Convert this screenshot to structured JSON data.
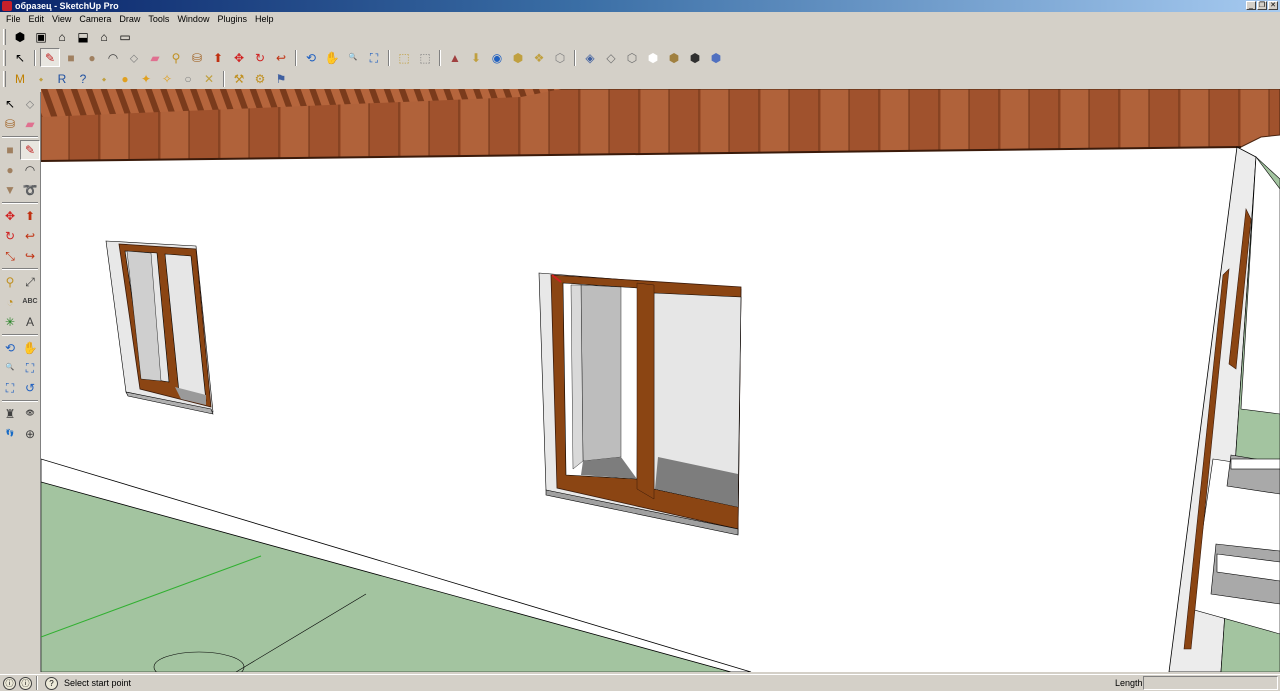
{
  "window": {
    "title": "образец - SketchUp Pro",
    "controls": {
      "minimize": "_",
      "restore": "❐",
      "close": "✕"
    }
  },
  "menu": [
    "File",
    "Edit",
    "View",
    "Camera",
    "Draw",
    "Tools",
    "Window",
    "Plugins",
    "Help"
  ],
  "toolbar_top": {
    "views": [
      {
        "name": "iso-view-icon",
        "glyph": "⬢"
      },
      {
        "name": "top-view-icon",
        "glyph": "▣"
      },
      {
        "name": "front-view-icon",
        "glyph": "⌂"
      },
      {
        "name": "right-view-icon",
        "glyph": "⬓"
      },
      {
        "name": "back-view-icon",
        "glyph": "⌂"
      },
      {
        "name": "left-view-icon",
        "glyph": "▭"
      }
    ]
  },
  "toolbar_main": [
    {
      "name": "select-icon",
      "glyph": "↖",
      "color": "#000000"
    },
    {
      "name": "line-icon",
      "glyph": "✎",
      "color": "#c02020",
      "selected": true
    },
    {
      "name": "rectangle-icon",
      "glyph": "■",
      "color": "#a08060"
    },
    {
      "name": "circle-icon",
      "glyph": "●",
      "color": "#a08060"
    },
    {
      "name": "arc-icon",
      "glyph": "◠",
      "color": "#404040"
    },
    {
      "name": "make-component-icon",
      "glyph": "⬦",
      "color": "#808080"
    },
    {
      "name": "eraser-icon",
      "glyph": "▰",
      "color": "#e07090"
    },
    {
      "name": "tape-measure-icon",
      "glyph": "⚲",
      "color": "#c09020"
    },
    {
      "name": "paint-bucket-icon",
      "glyph": "⛁",
      "color": "#a06020"
    },
    {
      "name": "push-pull-icon",
      "glyph": "⬆",
      "color": "#c03010"
    },
    {
      "name": "move-icon",
      "glyph": "✥",
      "color": "#d02020"
    },
    {
      "name": "rotate-icon",
      "glyph": "↻",
      "color": "#d02020"
    },
    {
      "name": "follow-me-icon",
      "glyph": "↩",
      "color": "#c03010"
    },
    {
      "name": "orbit-icon",
      "glyph": "⟲",
      "color": "#2060c0"
    },
    {
      "name": "pan-icon",
      "glyph": "✋",
      "color": "#404040"
    },
    {
      "name": "zoom-icon",
      "glyph": "🔍",
      "color": "#2060c0"
    },
    {
      "name": "zoom-extents-icon",
      "glyph": "⛶",
      "color": "#2060c0"
    },
    {
      "name": "previous-view-icon",
      "glyph": "⬚",
      "color": "#c0a040"
    },
    {
      "name": "next-view-icon",
      "glyph": "⬚",
      "color": "#808080"
    },
    {
      "name": "place-model-icon",
      "glyph": "▲",
      "color": "#a04040"
    },
    {
      "name": "get-models-icon",
      "glyph": "⬇",
      "color": "#c0a040"
    },
    {
      "name": "share-model-icon",
      "glyph": "◉",
      "color": "#2060c0"
    },
    {
      "name": "share-component-icon",
      "glyph": "⬢",
      "color": "#c0a040"
    },
    {
      "name": "component-icon",
      "glyph": "❖",
      "color": "#c0a040"
    },
    {
      "name": "warehouse-icon",
      "glyph": "⬡",
      "color": "#808080"
    },
    {
      "name": "xray-icon",
      "glyph": "◈",
      "color": "#4060a0"
    },
    {
      "name": "back-edges-icon",
      "glyph": "◇",
      "color": "#707070"
    },
    {
      "name": "wireframe-icon",
      "glyph": "⬡",
      "color": "#707070"
    },
    {
      "name": "hidden-line-icon",
      "glyph": "⬢",
      "color": "#ffffff"
    },
    {
      "name": "shaded-icon",
      "glyph": "⬢",
      "color": "#a08040"
    },
    {
      "name": "shaded-textures-icon",
      "glyph": "⬢",
      "color": "#303030"
    },
    {
      "name": "monochrome-icon",
      "glyph": "⬢",
      "color": "#5070c0"
    }
  ],
  "toolbar_plugins": [
    {
      "name": "plugin-m-icon",
      "glyph": "M",
      "color": "#c08000"
    },
    {
      "name": "plugin-tag-icon",
      "glyph": "⬩",
      "color": "#c0a040"
    },
    {
      "name": "plugin-r-icon",
      "glyph": "R",
      "color": "#2050a0"
    },
    {
      "name": "plugin-help-icon",
      "glyph": "?",
      "color": "#2050a0"
    },
    {
      "name": "plugin-tag2-icon",
      "glyph": "⬩",
      "color": "#c0a040"
    },
    {
      "name": "plugin-sphere-icon",
      "glyph": "●",
      "color": "#e0a020"
    },
    {
      "name": "plugin-light-icon",
      "glyph": "✦",
      "color": "#e0a020"
    },
    {
      "name": "plugin-light2-icon",
      "glyph": "✧",
      "color": "#e0a020"
    },
    {
      "name": "plugin-ball-icon",
      "glyph": "○",
      "color": "#808080"
    },
    {
      "name": "plugin-cross-icon",
      "glyph": "✕",
      "color": "#c0a040"
    },
    {
      "name": "plugin-tool1-icon",
      "glyph": "⚒",
      "color": "#c09020"
    },
    {
      "name": "plugin-tool2-icon",
      "glyph": "⚙",
      "color": "#c09020"
    },
    {
      "name": "plugin-tool3-icon",
      "glyph": "⚑",
      "color": "#4060a0"
    }
  ],
  "toolbar_left": [
    [
      {
        "name": "select-icon",
        "glyph": "↖",
        "color": "#000000"
      },
      {
        "name": "make-component-icon",
        "glyph": "⬦",
        "color": "#808080"
      }
    ],
    [
      {
        "name": "paint-bucket-icon",
        "glyph": "⛁",
        "color": "#a06020"
      },
      {
        "name": "eraser-icon",
        "glyph": "▰",
        "color": "#e07090"
      }
    ],
    [
      {
        "name": "rectangle-icon",
        "glyph": "■",
        "color": "#a08060"
      },
      {
        "name": "line-icon",
        "glyph": "✎",
        "color": "#c02020",
        "selected": true
      }
    ],
    [
      {
        "name": "circle-icon",
        "glyph": "●",
        "color": "#a08060"
      },
      {
        "name": "arc-icon",
        "glyph": "◠",
        "color": "#404040"
      }
    ],
    [
      {
        "name": "polygon-icon",
        "glyph": "▼",
        "color": "#a08060"
      },
      {
        "name": "freehand-icon",
        "glyph": "➰",
        "color": "#404040"
      }
    ],
    [
      {
        "name": "move-icon",
        "glyph": "✥",
        "color": "#d02020"
      },
      {
        "name": "push-pull-icon",
        "glyph": "⬆",
        "color": "#c03010"
      }
    ],
    [
      {
        "name": "rotate-icon",
        "glyph": "↻",
        "color": "#d02020"
      },
      {
        "name": "follow-me-icon",
        "glyph": "↩",
        "color": "#c03010"
      }
    ],
    [
      {
        "name": "scale-icon",
        "glyph": "⤡",
        "color": "#c03010"
      },
      {
        "name": "offset-icon",
        "glyph": "↪",
        "color": "#c03010"
      }
    ],
    [
      {
        "name": "tape-measure-icon",
        "glyph": "⚲",
        "color": "#c09020"
      },
      {
        "name": "dimension-icon",
        "glyph": "⤢",
        "color": "#404040"
      }
    ],
    [
      {
        "name": "protractor-icon",
        "glyph": "◔",
        "color": "#c09020"
      },
      {
        "name": "text-icon",
        "glyph": "ABC",
        "color": "#404040"
      }
    ],
    [
      {
        "name": "axes-icon",
        "glyph": "✳",
        "color": "#208020"
      },
      {
        "name": "3d-text-icon",
        "glyph": "A",
        "color": "#404040"
      }
    ],
    [
      {
        "name": "orbit-icon",
        "glyph": "⟲",
        "color": "#2060c0"
      },
      {
        "name": "pan-icon",
        "glyph": "✋",
        "color": "#404040"
      }
    ],
    [
      {
        "name": "zoom-icon",
        "glyph": "🔍",
        "color": "#2060c0"
      },
      {
        "name": "zoom-window-icon",
        "glyph": "⛶",
        "color": "#2060c0"
      }
    ],
    [
      {
        "name": "zoom-extents-icon",
        "glyph": "⛶",
        "color": "#2060c0"
      },
      {
        "name": "previous-icon",
        "glyph": "↺",
        "color": "#2060c0"
      }
    ],
    [
      {
        "name": "position-camera-icon",
        "glyph": "♜",
        "color": "#404040"
      },
      {
        "name": "look-around-icon",
        "glyph": "👁",
        "color": "#404040"
      }
    ],
    [
      {
        "name": "walk-icon",
        "glyph": "👣",
        "color": "#404040"
      },
      {
        "name": "section-plane-icon",
        "glyph": "⊕",
        "color": "#404040"
      }
    ]
  ],
  "status": {
    "icons": [
      "ⓘ",
      "ⓘ",
      "?"
    ],
    "message": "Select start point",
    "measurement_label": "Length",
    "measurement_value": ""
  },
  "scene": {
    "wall_color": "#ffffff",
    "ground_color": "#a3c4a0",
    "eave_color": "#a0522d",
    "frame_color": "#8b4513",
    "glass_color": "#e6e6e6"
  }
}
